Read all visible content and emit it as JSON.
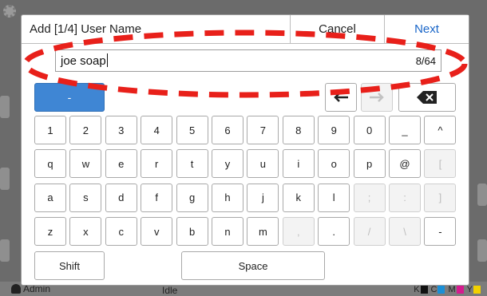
{
  "background": {
    "user_label": "Admin",
    "status_text": "Idle",
    "toner": [
      {
        "label": "K",
        "color": "#111111"
      },
      {
        "label": "C",
        "color": "#1b8fd6"
      },
      {
        "label": "M",
        "color": "#d61b8f"
      },
      {
        "label": "Y",
        "color": "#f2d100"
      }
    ]
  },
  "dialog": {
    "title": "Add [1/4] User Name",
    "cancel_label": "Cancel",
    "next_label": "Next",
    "input": {
      "value": "joe soap",
      "counter": "8/64"
    }
  },
  "keyboard": {
    "mode_key": "-",
    "arrow_left": "←",
    "arrow_right": "→",
    "backspace": "✕",
    "row1": [
      "1",
      "2",
      "3",
      "4",
      "5",
      "6",
      "7",
      "8",
      "9",
      "0",
      "_",
      "^"
    ],
    "row2": [
      "q",
      "w",
      "e",
      "r",
      "t",
      "y",
      "u",
      "i",
      "o",
      "p",
      "@",
      "["
    ],
    "row3": [
      "a",
      "s",
      "d",
      "f",
      "g",
      "h",
      "j",
      "k",
      "l",
      ";",
      ":",
      "]"
    ],
    "row4": [
      "z",
      "x",
      "c",
      "v",
      "b",
      "n",
      "m",
      ",",
      ".",
      "/",
      "\\",
      "-"
    ],
    "disabled_keys": [
      "[",
      ";",
      ":",
      "]",
      ",",
      "/",
      "\\"
    ],
    "shift_label": "Shift",
    "space_label": "Space"
  },
  "annotation": {
    "color": "#e8201a",
    "shape": "dashed-ellipse"
  }
}
